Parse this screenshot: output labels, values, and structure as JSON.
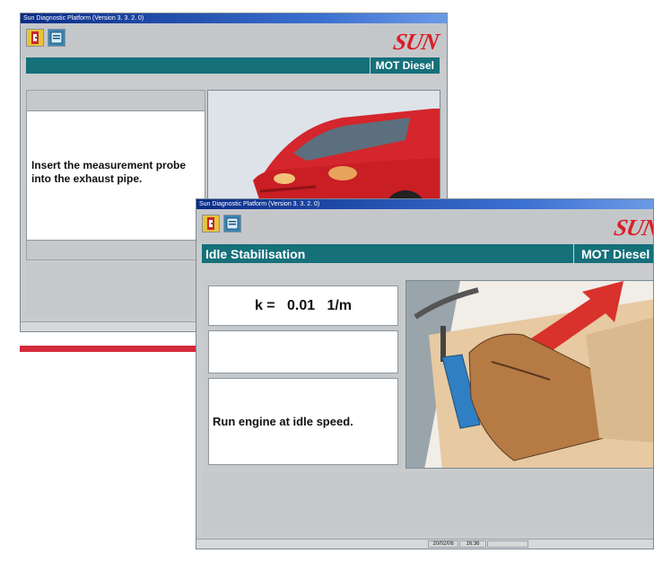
{
  "window_back": {
    "title": "Sun Diagnostic Platform (Version 3. 3. 2. 0)",
    "mode_label": "MOT Diesel",
    "instruction": "Insert the measurement probe into the exhaust pipe.",
    "logo": "SUN"
  },
  "window_front": {
    "title": "Sun Diagnostic Platform (Version 3. 3. 2. 0)",
    "step_label": "Idle Stabilisation",
    "mode_label": "MOT Diesel",
    "reading": "k =   0.01   1/m",
    "instruction": "Run engine at idle speed.",
    "logo": "SUN",
    "status": {
      "date": "20/02/06",
      "time": "16:36"
    }
  },
  "colors": {
    "teal_bar": "#15707a",
    "logo_red": "#d8202a",
    "divider_red": "#d42a3a"
  },
  "icons": [
    "exit-icon",
    "info-icon"
  ]
}
